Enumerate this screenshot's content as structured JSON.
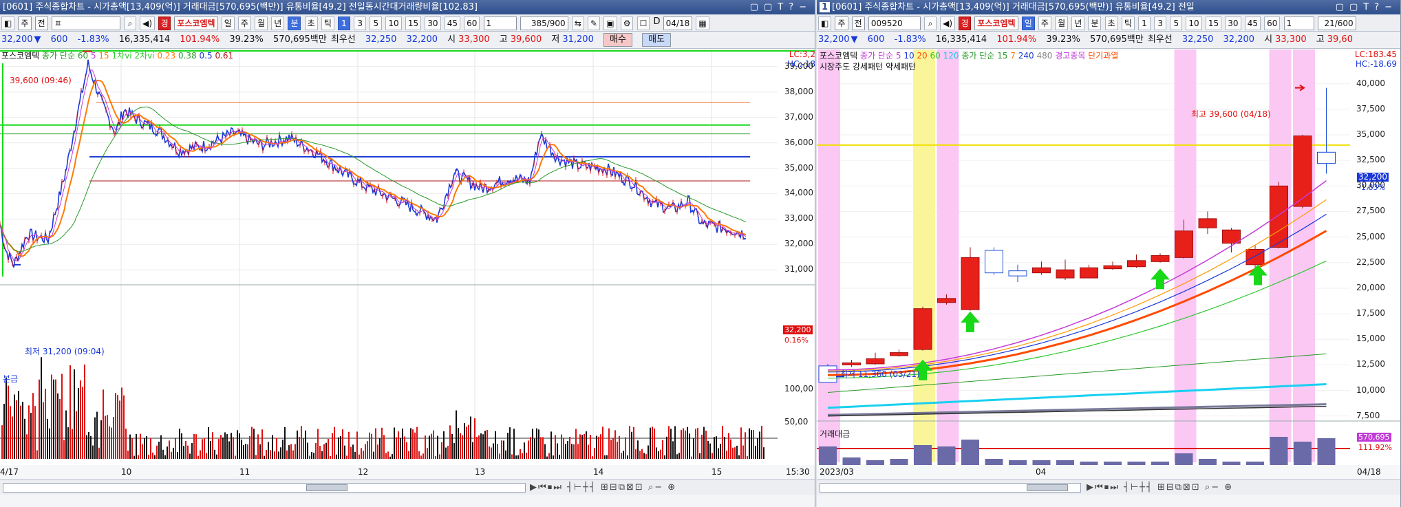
{
  "left": {
    "title": "[0601] 주식종합차트 - 시가총액[13,409(억)] 거래대금[570,695(백만)] 유통비율[49.2] 전일동시간대거래량비율[102.83]",
    "toolbar": {
      "mode1": "주",
      "mode2": "전",
      "search": "ㅍ",
      "stock_name": "포스코엠텍",
      "periods": [
        "일",
        "주",
        "월",
        "년",
        "분",
        "초",
        "틱"
      ],
      "selected_period": "분",
      "intervals": [
        "1",
        "3",
        "5",
        "10",
        "15",
        "30",
        "45",
        "60"
      ],
      "selected_interval": "1",
      "interval_select": "1",
      "count": "385/900",
      "d_label": "D",
      "date": "04/18"
    },
    "info": {
      "price": "32,200",
      "change": "600",
      "rate": "-1.83%",
      "volume": "16,335,414",
      "ratio1": "101.94%",
      "ratio2": "39.23%",
      "amount": "570,695백만",
      "best_label": "최우선",
      "best_sell": "32,250",
      "best_buy": "32,200",
      "open_label": "시",
      "open": "33,300",
      "high_label": "고",
      "high": "39,600",
      "low_label": "저",
      "low": "31,200",
      "buy": "매수",
      "sell": "매도"
    },
    "legend": {
      "name": "포스코엠텍",
      "ma_label": "종가 단순",
      "ma1": "60",
      "ma2": "5",
      "ma3": "15",
      "r1": "1차vi",
      "r2": "2차vi",
      "f1": "0.23",
      "f2": "0.38",
      "f3": "0.5",
      "f4": "0.61"
    },
    "axis_right_top": "LC:3,2",
    "axis_right_top2": "HC:-18",
    "y_labels": [
      "39,000",
      "38,000",
      "37,000",
      "36,000",
      "35,000",
      "34,000",
      "33,000",
      "32,000",
      "31,000"
    ],
    "current_tag": "32,200",
    "current_pct": "0.16%",
    "high_annotation": "39,600 (09:46)",
    "low_annotation": "최저 31,200 (09:04)",
    "volume_label": "분금",
    "vol_y_labels": [
      "100,00",
      "50,00"
    ],
    "dates": [
      "4/17",
      "10",
      "11",
      "12",
      "13",
      "14",
      "15"
    ],
    "time_right": "15:30"
  },
  "right": {
    "title": "[0601] 주식종합차트 - 시가총액[13,409(억)] 거래대금[570,695(백만)] 유통비율[49.2] 전일",
    "toolbar": {
      "mode1": "주",
      "mode2": "전",
      "code": "009520",
      "stock_name": "포스코엠텍",
      "periods": [
        "일",
        "주",
        "월",
        "년",
        "분",
        "초",
        "틱"
      ],
      "selected_period": "일",
      "intervals": [
        "1",
        "3",
        "5",
        "10",
        "15",
        "30",
        "45",
        "60"
      ],
      "interval_select": "1",
      "count": "21/600"
    },
    "info": {
      "price": "32,200",
      "change": "600",
      "rate": "-1.83%",
      "volume": "16,335,414",
      "ratio1": "101.94%",
      "ratio2": "39.23%",
      "amount": "570,695백만",
      "best_label": "최우선",
      "best_sell": "32,250",
      "best_buy": "32,200",
      "open_label": "시",
      "open": "33,300",
      "high_label": "고",
      "high": "39,60"
    },
    "legend": {
      "name": "포스코엠텍",
      "ma_label": "종가 단순",
      "ma1": "5",
      "ma2": "10",
      "ma3": "20",
      "ma4": "60",
      "ma5": "120",
      "ma_label2": "종가 단순",
      "mb1": "15",
      "mb2": "7",
      "mb3": "240",
      "mb4": "480",
      "warn": "경고종목",
      "overheat": "단기과열"
    },
    "legend2": "시장주도 강세패턴 약세패턴",
    "axis_right_top": "LC:183.45",
    "axis_right_top2": "HC:-18.69",
    "y_labels": [
      "40,000",
      "37,500",
      "35,000",
      "32,500",
      "30,000",
      "27,500",
      "25,000",
      "22,500",
      "20,000",
      "17,500",
      "15,000",
      "12,500",
      "10,000",
      "7,500"
    ],
    "current_tag": "32,200",
    "current_pct": "-1.83%",
    "high_annotation": "최고 39,600 (04/18)",
    "low_annotation": "최저 11,360 (03/21)",
    "volume_label": "거래대금",
    "vol_tag": "570,695",
    "vol_pct": "111.92%",
    "dates": [
      "2023/03",
      "04"
    ],
    "date_right": "04/18",
    "colors": {
      "up": "#e8201a",
      "down": "#1a4fd8",
      "highlight_pink": "#fbc8f4",
      "highlight_yellow": "#fbf59a",
      "volume": "#6a6aa8"
    }
  }
}
